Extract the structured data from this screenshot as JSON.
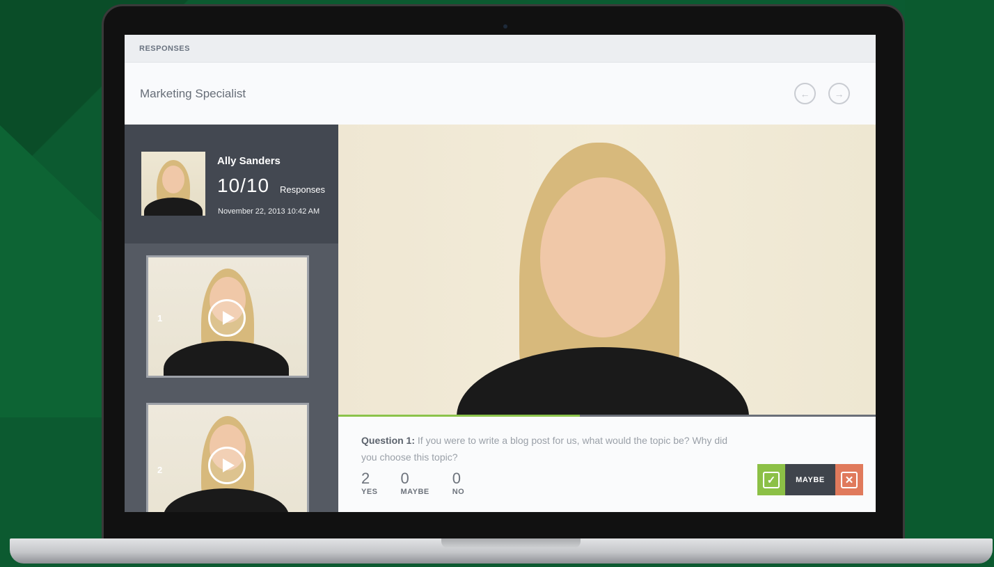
{
  "topbar": {
    "label": "RESPONSES"
  },
  "header": {
    "title": "Marketing Specialist",
    "prev_icon": "arrow-left-circle-icon",
    "next_icon": "arrow-right-circle-icon"
  },
  "profile": {
    "name": "Ally Sanders",
    "count": "10/10",
    "count_label": "Responses",
    "date": "November 22, 2013 10:42 AM"
  },
  "thumbnails": [
    {
      "number": "1"
    },
    {
      "number": "2"
    }
  ],
  "video": {
    "progress": 0.45
  },
  "question": {
    "label": "Question 1:",
    "text": "If you were to write a blog post for us, what would the topic be? Why did you choose this topic?"
  },
  "votes": [
    {
      "count": "2",
      "label": "YES"
    },
    {
      "count": "0",
      "label": "MAYBE"
    },
    {
      "count": "0",
      "label": "NO"
    }
  ],
  "decision": {
    "yes_glyph": "✓",
    "maybe_label": "MAYBE",
    "no_glyph": "✕"
  },
  "colors": {
    "accent_green": "#8cc046",
    "reject_orange": "#e07a5c",
    "sidebar_dark": "#434851",
    "background_green": "#0c5a30"
  }
}
